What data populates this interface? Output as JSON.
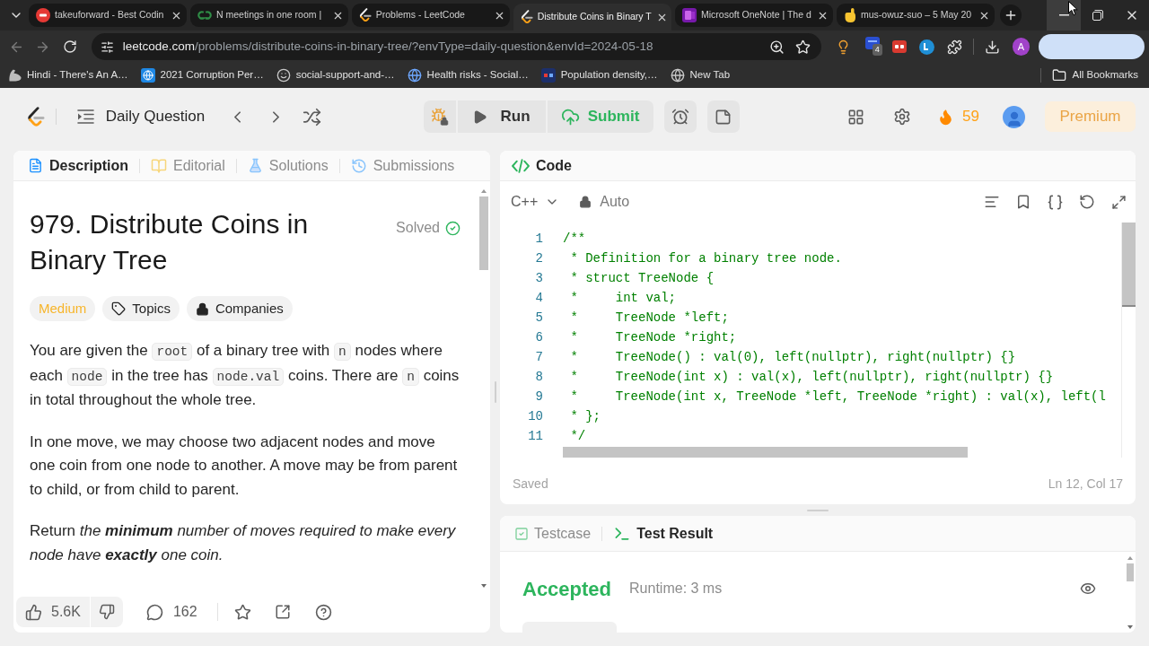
{
  "browser": {
    "tabs": [
      {
        "title": "takeuforward - Best Codin",
        "selected": false
      },
      {
        "title": "N meetings in one room |",
        "selected": false
      },
      {
        "title": "Problems - LeetCode",
        "selected": false
      },
      {
        "title": "Distribute Coins in Binary T",
        "selected": true
      },
      {
        "title": "Microsoft OneNote | The d",
        "selected": false
      },
      {
        "title": "mus-owuz-suo – 5 May 20",
        "selected": false
      }
    ],
    "address_bar": {
      "host": "leetcode.com",
      "path": "/problems/distribute-coins-in-binary-tree/?envType=daily-question&envId=2024-05-18"
    },
    "extension_badge": "4",
    "profile_initial": "A",
    "bookmarks": [
      "Hindi - There's An A…",
      "2021 Corruption Per…",
      "social-support-and-…",
      "Health risks - Social…",
      "Population density,…",
      "New Tab"
    ],
    "all_bookmarks": "All Bookmarks"
  },
  "header": {
    "title": "Daily Question",
    "run": "Run",
    "submit": "Submit",
    "streak": "59",
    "premium": "Premium"
  },
  "problem_panel": {
    "tabs": [
      {
        "label": "Description",
        "selected": true
      },
      {
        "label": "Editorial",
        "selected": false
      },
      {
        "label": "Solutions",
        "selected": false
      },
      {
        "label": "Submissions",
        "selected": false
      }
    ],
    "title": "979. Distribute Coins in Binary Tree",
    "status": "Solved",
    "difficulty": "Medium",
    "tags": [
      "Topics",
      "Companies"
    ],
    "paragraphs": [
      {
        "segments": [
          {
            "kind": "text",
            "text": "You are given the "
          },
          {
            "kind": "code",
            "text": "root"
          },
          {
            "kind": "text",
            "text": " of a binary tree with "
          },
          {
            "kind": "code",
            "text": "n"
          },
          {
            "kind": "text",
            "text": " nodes where each "
          },
          {
            "kind": "code",
            "text": "node"
          },
          {
            "kind": "text",
            "text": " in the tree has "
          },
          {
            "kind": "code",
            "text": "node.val"
          },
          {
            "kind": "text",
            "text": " coins. There are "
          },
          {
            "kind": "code",
            "text": "n"
          },
          {
            "kind": "text",
            "text": " coins in total throughout the whole tree."
          }
        ]
      },
      {
        "segments": [
          {
            "kind": "text",
            "text": "In one move, we may choose two adjacent nodes and move one coin from one node to another. A move may be from parent to child, or from child to parent."
          }
        ]
      },
      {
        "segments": [
          {
            "kind": "text",
            "text": "Return "
          },
          {
            "kind": "em",
            "text": "the "
          },
          {
            "kind": "strong-em",
            "text": "minimum"
          },
          {
            "kind": "em",
            "text": " number of moves required to make every node have "
          },
          {
            "kind": "strong-em",
            "text": "exactly"
          },
          {
            "kind": "em",
            "text": " one coin."
          }
        ]
      }
    ],
    "likes": "5.6K",
    "comments": "162"
  },
  "code_panel": {
    "title": "Code",
    "language": "C++",
    "mode": "Auto",
    "lines": [
      {
        "number": "1",
        "text": "/**"
      },
      {
        "number": "2",
        "text": " * Definition for a binary tree node."
      },
      {
        "number": "3",
        "text": " * struct TreeNode {"
      },
      {
        "number": "4",
        "text": " *     int val;"
      },
      {
        "number": "5",
        "text": " *     TreeNode *left;"
      },
      {
        "number": "6",
        "text": " *     TreeNode *right;"
      },
      {
        "number": "7",
        "text": " *     TreeNode() : val(0), left(nullptr), right(nullptr) {}"
      },
      {
        "number": "8",
        "text": " *     TreeNode(int x) : val(x), left(nullptr), right(nullptr) {}"
      },
      {
        "number": "9",
        "text": " *     TreeNode(int x, TreeNode *left, TreeNode *right) : val(x), left(l"
      },
      {
        "number": "10",
        "text": " * };"
      },
      {
        "number": "11",
        "text": " */"
      }
    ],
    "status": "Saved",
    "cursor": "Ln 12, Col 17"
  },
  "result_panel": {
    "tabs": [
      {
        "label": "Testcase",
        "selected": false
      },
      {
        "label": "Test Result",
        "selected": true
      }
    ],
    "verdict": "Accepted",
    "runtime": "Runtime: 3 ms"
  }
}
